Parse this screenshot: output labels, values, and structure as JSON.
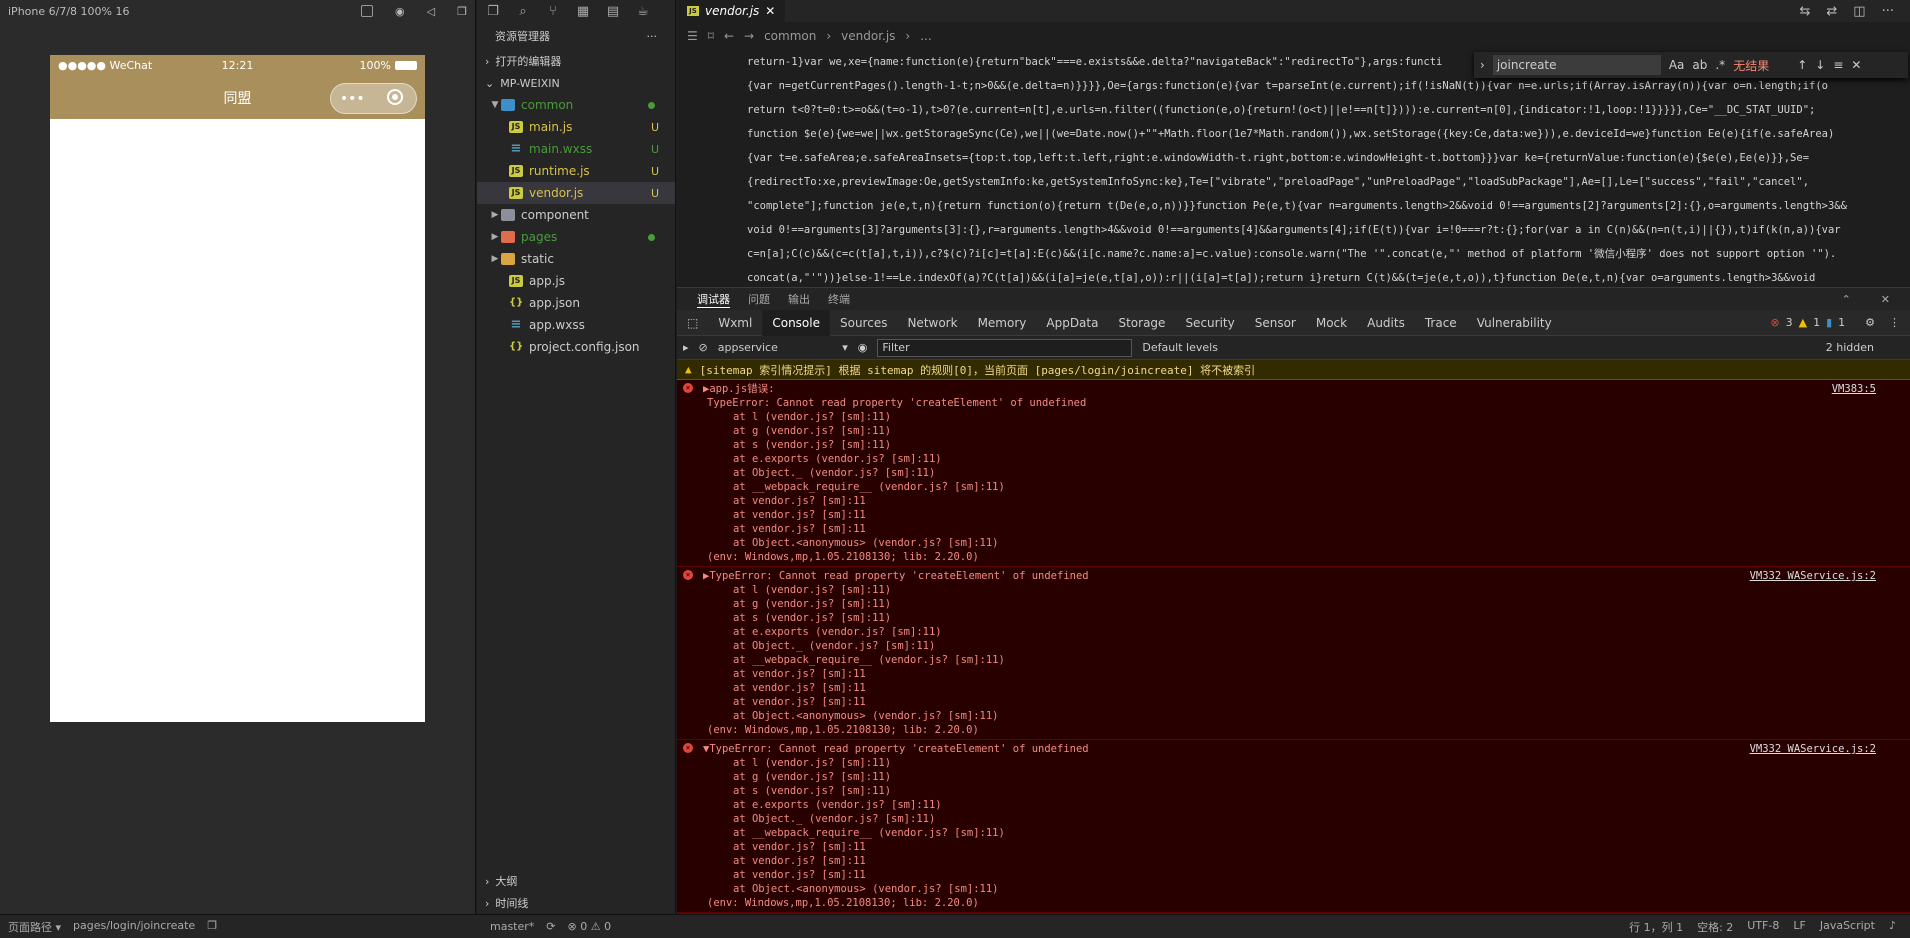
{
  "simulator": {
    "device": "iPhone 6/7/8 100% 16",
    "carrier": "●●●●● WeChat",
    "time": "12:21",
    "battery": "100%",
    "page_title": "同盟",
    "capsule_more": "•••",
    "brand_color": "#a88f5c"
  },
  "explorer": {
    "title": "资源管理器",
    "more": "···",
    "open_editors": "打开的编辑器",
    "project": "MP-WEIXIN",
    "tree": [
      {
        "label": "common",
        "type": "folder-open",
        "color": "#4b9a3c",
        "status": "dot"
      },
      {
        "label": "main.js",
        "type": "js",
        "color": "#d7c34a",
        "status": "U"
      },
      {
        "label": "main.wxss",
        "type": "css",
        "color": "#4b9a3c",
        "status": "U"
      },
      {
        "label": "runtime.js",
        "type": "js",
        "color": "#d7c34a",
        "status": "U"
      },
      {
        "label": "vendor.js",
        "type": "js",
        "color": "#d7c34a",
        "status": "U"
      },
      {
        "label": "component",
        "type": "folder",
        "color": "#cccccc",
        "status": ""
      },
      {
        "label": "pages",
        "type": "folder-red",
        "color": "#4b9a3c",
        "status": "dot"
      },
      {
        "label": "static",
        "type": "folder-yellow",
        "color": "#cccccc",
        "status": ""
      },
      {
        "label": "app.js",
        "type": "js",
        "color": "#cccccc",
        "status": ""
      },
      {
        "label": "app.json",
        "type": "json",
        "color": "#cccccc",
        "status": ""
      },
      {
        "label": "app.wxss",
        "type": "css",
        "color": "#cccccc",
        "status": ""
      },
      {
        "label": "project.config.json",
        "type": "json",
        "color": "#cccccc",
        "status": ""
      }
    ],
    "outline": "大纲",
    "timeline": "时间线"
  },
  "editor": {
    "tab": "vendor.js",
    "breadcrumb_1": "common",
    "breadcrumb_2": "vendor.js",
    "breadcrumb_3": "...",
    "find_query": "joincreate",
    "find_result": "无结果",
    "code_lines": [
      "return-1}var we,xe={name:function(e){return\"back\"===e.exists&&e.delta?\"navigateBack\":\"redirectTo\"},args:functi",
      "{var n=getCurrentPages().length-1-t;n>0&&(e.delta=n)}}}},Oe={args:function(e){var t=parseInt(e.current);if(!isNaN(t)){var n=e.urls;if(Array.isArray(n)){var o=n.length;if(o",
      "return t<0?t=0:t>=o&&(t=o-1),t>0?(e.current=n[t],e.urls=n.filter((function(e,o){return!(o<t)||e!==n[t]}))):e.current=n[0],{indicator:!1,loop:!1}}}}},Ce=\"__DC_STAT_UUID\";",
      "function $e(e){we=we||wx.getStorageSync(Ce),we||(we=Date.now()+\"\"+Math.floor(1e7*Math.random()),wx.setStorage({key:Ce,data:we})),e.deviceId=we}function Ee(e){if(e.safeArea)",
      "{var t=e.safeArea;e.safeAreaInsets={top:t.top,left:t.left,right:e.windowWidth-t.right,bottom:e.windowHeight-t.bottom}}}var ke={returnValue:function(e){$e(e),Ee(e)}},Se=",
      "{redirectTo:xe,previewImage:Oe,getSystemInfo:ke,getSystemInfoSync:ke},Te=[\"vibrate\",\"preloadPage\",\"unPreloadPage\",\"loadSubPackage\"],Ae=[],Le=[\"success\",\"fail\",\"cancel\",",
      "\"complete\"];function je(e,t,n){return function(o){return t(De(e,o,n))}}function Pe(e,t){var n=arguments.length>2&&void 0!==arguments[2]?arguments[2]:{},o=arguments.length>3&&",
      "void 0!==arguments[3]?arguments[3]:{},r=arguments.length>4&&void 0!==arguments[4]&&arguments[4];if(E(t)){var i=!0===r?t:{};for(var a in C(n)&&(n=n(t,i)||{}),t)if(k(n,a)){var",
      "c=n[a];C(c)&&(c=c(t[a],t,i)),c?$(c)?i[c]=t[a]:E(c)&&(i[c.name?c.name:a]=c.value):console.warn(\"The '\".concat(e,\"' method of platform '微信小程序' does not support option '\").",
      "concat(a,\"'\"))}else-1!==Le.indexOf(a)?C(t[a])&&(i[a]=je(e,t[a],o)):r||(i[a]=t[a]);return i}return C(t)&&(t=je(e,t,o)),t}function De(e,t,n){var o=arguments.length>3&&void"
    ]
  },
  "devtools": {
    "top_tabs": [
      "调试器",
      "问题",
      "输出",
      "终端"
    ],
    "panels": [
      "Wxml",
      "Console",
      "Sources",
      "Network",
      "Memory",
      "AppData",
      "Storage",
      "Security",
      "Sensor",
      "Mock",
      "Audits",
      "Trace",
      "Vulnerability"
    ],
    "active_panel": "Console",
    "error_count": "3",
    "warn_count": "1",
    "info_count": "1",
    "context": "appservice",
    "filter_placeholder": "Filter",
    "levels": "Default levels",
    "hidden": "2 hidden",
    "warning": "[sitemap 索引情况提示] 根据 sitemap 的规则[0]，当前页面 [pages/login/joincreate] 将不被索引",
    "errors": [
      {
        "head": "▶app.js错误:",
        "message": "TypeError: Cannot read property 'createElement' of undefined",
        "source": "VM383:5",
        "frames": [
          "at l (vendor.js? [sm]:11)",
          "at g (vendor.js? [sm]:11)",
          "at s (vendor.js? [sm]:11)",
          "at e.exports (vendor.js? [sm]:11)",
          "at Object._ (vendor.js? [sm]:11)",
          "at __webpack_require__ (vendor.js? [sm]:11)",
          "at vendor.js? [sm]:11",
          "at vendor.js? [sm]:11",
          "at vendor.js? [sm]:11",
          "at Object.<anonymous> (vendor.js? [sm]:11)"
        ],
        "env": "(env: Windows,mp,1.05.2108130; lib: 2.20.0)"
      },
      {
        "head": "▶TypeError: Cannot read property 'createElement' of undefined",
        "message": "",
        "source": "VM332 WAService.js:2",
        "frames": [
          "at l (vendor.js? [sm]:11)",
          "at g (vendor.js? [sm]:11)",
          "at s (vendor.js? [sm]:11)",
          "at e.exports (vendor.js? [sm]:11)",
          "at Object._ (vendor.js? [sm]:11)",
          "at __webpack_require__ (vendor.js? [sm]:11)",
          "at vendor.js? [sm]:11",
          "at vendor.js? [sm]:11",
          "at vendor.js? [sm]:11",
          "at Object.<anonymous> (vendor.js? [sm]:11)"
        ],
        "env": "(env: Windows,mp,1.05.2108130; lib: 2.20.0)"
      },
      {
        "head": "▼TypeError: Cannot read property 'createElement' of undefined",
        "message": "",
        "source": "VM332 WAService.js:2",
        "frames": [
          "at l (vendor.js? [sm]:11)",
          "at g (vendor.js? [sm]:11)",
          "at s (vendor.js? [sm]:11)",
          "at e.exports (vendor.js? [sm]:11)",
          "at Object._ (vendor.js? [sm]:11)",
          "at __webpack_require__ (vendor.js? [sm]:11)",
          "at vendor.js? [sm]:11",
          "at vendor.js? [sm]:11",
          "at vendor.js? [sm]:11",
          "at Object.<anonymous> (vendor.js? [sm]:11)"
        ],
        "env": "(env: Windows,mp,1.05.2108130; lib: 2.20.0)"
      }
    ]
  },
  "statusbar": {
    "page_path_label": "页面路径 ▾",
    "page_path": "pages/login/joincreate",
    "branch": "master*",
    "problems": "⊗ 0 ⚠ 0",
    "position": "行 1，列 1",
    "spaces": "空格: 2",
    "encoding": "UTF-8",
    "eol": "LF",
    "language": "JavaScript"
  }
}
